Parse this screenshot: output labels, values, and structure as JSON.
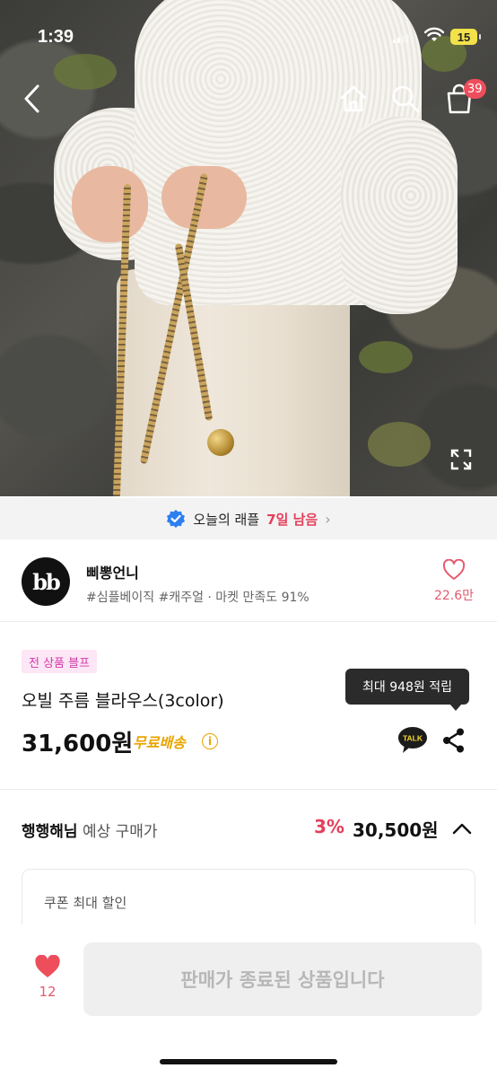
{
  "status_bar": {
    "time": "1:39",
    "battery": "15"
  },
  "header": {
    "back_icon": "chevron-left-icon",
    "home_icon": "home-icon",
    "search_icon": "search-icon",
    "cart_icon": "shopping-bag-icon",
    "cart_count": "39",
    "expand_icon": "fullscreen-icon"
  },
  "raffle": {
    "prefix": "오늘의 래플",
    "days_left": "7일 남음",
    "chevron": "›"
  },
  "shop": {
    "logo_text": "bb",
    "name": "삐뽕언니",
    "tags": "#심플베이직 #캐주얼 · 마켓 만족도 91%",
    "fav_count": "22.6만"
  },
  "product": {
    "promo_badge": "전 상품 블프",
    "name": "오빌 주름 블라우스(3color)",
    "tooltip": "최대 948원 적립",
    "price": "31,600원",
    "shipping": "무료배송",
    "info_icon": "i",
    "talk_label": "TALK"
  },
  "expected": {
    "user": "행행해님",
    "label": "예상 구매가",
    "discount": "3%",
    "price": "30,500원"
  },
  "coupon": {
    "label": "쿠폰 최대 할인"
  },
  "bottom": {
    "like_count": "12",
    "buy_label": "판매가 종료된 상품입니다"
  },
  "colors": {
    "accent_red": "#e43f5a",
    "heart_pink": "#e45a6e",
    "shipping_yellow": "#e9a400",
    "promo_pink": "#d03aa8",
    "verified_blue": "#2d7ff0"
  }
}
